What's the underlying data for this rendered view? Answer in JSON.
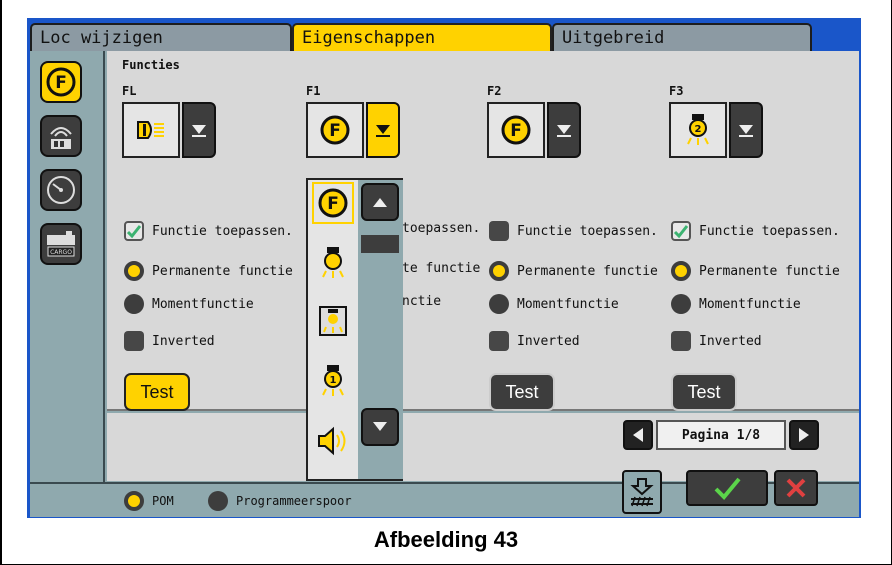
{
  "tabs": [
    {
      "label": "Loc wijzigen"
    },
    {
      "label": "Eigenschappen"
    },
    {
      "label": "Uitgebreid"
    }
  ],
  "section_title": "Functies",
  "functions": [
    {
      "label": "FL",
      "apply_label": "Functie toepassen.",
      "apply_checked": true,
      "permanent_label": "Permanente functie",
      "moment_label": "Momentfunctie",
      "inverted_label": "Inverted",
      "mode": "permanent",
      "test_label": "Test",
      "test_active": true,
      "icon": "headlight-icon"
    },
    {
      "label": "F1",
      "apply_label": "toepassen.",
      "apply_checked": false,
      "permanent_label": "te functie",
      "moment_label": "nctie",
      "inverted_label": "",
      "mode": "permanent",
      "test_label": "",
      "test_active": false,
      "icon": "function-f-icon"
    },
    {
      "label": "F2",
      "apply_label": "Functie toepassen.",
      "apply_checked": false,
      "permanent_label": "Permanente functie",
      "moment_label": "Momentfunctie",
      "inverted_label": "Inverted",
      "mode": "permanent",
      "test_label": "Test",
      "test_active": false,
      "icon": "function-f-icon"
    },
    {
      "label": "F3",
      "apply_label": "Functie toepassen.",
      "apply_checked": true,
      "permanent_label": "Permanente functie",
      "moment_label": "Momentfunctie",
      "inverted_label": "Inverted",
      "mode": "permanent",
      "test_label": "Test",
      "test_active": false,
      "icon": "lamp-2-icon"
    }
  ],
  "dropdown_options": [
    "function-f-icon",
    "lamp-icon",
    "cabin-light-icon",
    "lamp-1-icon",
    "horn-icon"
  ],
  "pagination": {
    "label": "Pagina 1/8"
  },
  "bottom": {
    "pom_label": "POM",
    "prog_label": "Programmeerspoor",
    "mode": "POM"
  },
  "caption": "Afbeelding 43",
  "colors": {
    "accent": "#ffd200",
    "panel": "#8fa9ae",
    "content": "#d8d8d8",
    "frame": "#1a56c9"
  }
}
